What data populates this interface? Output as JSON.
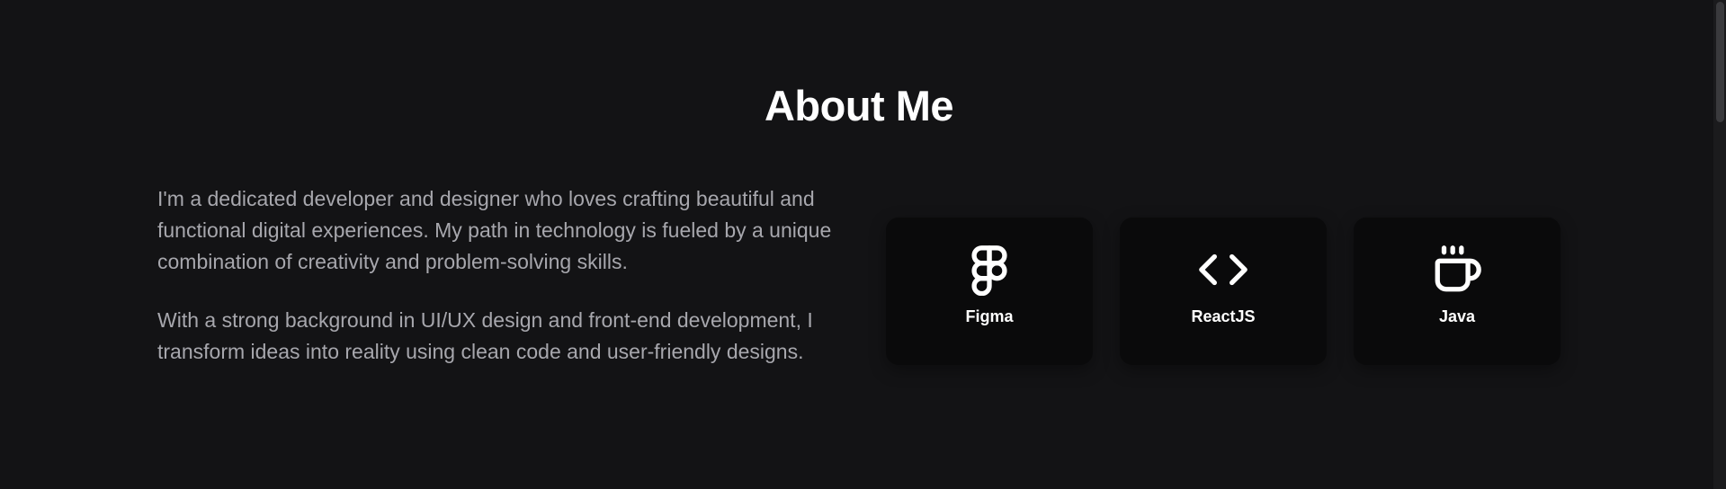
{
  "section": {
    "title": "About Me",
    "paragraphs": [
      "I'm a dedicated developer and designer who loves crafting beautiful and functional digital experiences. My path in technology is fueled by a unique combination of creativity and problem-solving skills.",
      "With a strong background in UI/UX design and front-end development, I transform ideas into reality using clean code and user-friendly designs."
    ]
  },
  "skills": [
    {
      "label": "Figma",
      "icon": "figma-icon"
    },
    {
      "label": "ReactJS",
      "icon": "code-icon"
    },
    {
      "label": "Java",
      "icon": "coffee-cup-icon"
    }
  ],
  "colors": {
    "background": "#131315",
    "card": "#0a0a0b",
    "heading": "#ffffff",
    "body_text": "#a7a7ad"
  }
}
